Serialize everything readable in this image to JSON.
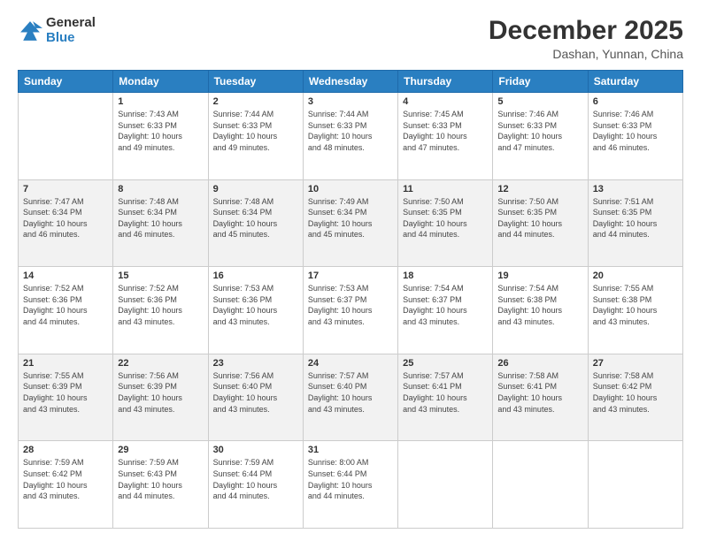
{
  "header": {
    "logo_line1": "General",
    "logo_line2": "Blue",
    "title": "December 2025",
    "subtitle": "Dashan, Yunnan, China"
  },
  "columns": [
    "Sunday",
    "Monday",
    "Tuesday",
    "Wednesday",
    "Thursday",
    "Friday",
    "Saturday"
  ],
  "weeks": [
    [
      {
        "day": "",
        "info": ""
      },
      {
        "day": "1",
        "info": "Sunrise: 7:43 AM\nSunset: 6:33 PM\nDaylight: 10 hours\nand 49 minutes."
      },
      {
        "day": "2",
        "info": "Sunrise: 7:44 AM\nSunset: 6:33 PM\nDaylight: 10 hours\nand 49 minutes."
      },
      {
        "day": "3",
        "info": "Sunrise: 7:44 AM\nSunset: 6:33 PM\nDaylight: 10 hours\nand 48 minutes."
      },
      {
        "day": "4",
        "info": "Sunrise: 7:45 AM\nSunset: 6:33 PM\nDaylight: 10 hours\nand 47 minutes."
      },
      {
        "day": "5",
        "info": "Sunrise: 7:46 AM\nSunset: 6:33 PM\nDaylight: 10 hours\nand 47 minutes."
      },
      {
        "day": "6",
        "info": "Sunrise: 7:46 AM\nSunset: 6:33 PM\nDaylight: 10 hours\nand 46 minutes."
      }
    ],
    [
      {
        "day": "7",
        "info": "Sunrise: 7:47 AM\nSunset: 6:34 PM\nDaylight: 10 hours\nand 46 minutes."
      },
      {
        "day": "8",
        "info": "Sunrise: 7:48 AM\nSunset: 6:34 PM\nDaylight: 10 hours\nand 46 minutes."
      },
      {
        "day": "9",
        "info": "Sunrise: 7:48 AM\nSunset: 6:34 PM\nDaylight: 10 hours\nand 45 minutes."
      },
      {
        "day": "10",
        "info": "Sunrise: 7:49 AM\nSunset: 6:34 PM\nDaylight: 10 hours\nand 45 minutes."
      },
      {
        "day": "11",
        "info": "Sunrise: 7:50 AM\nSunset: 6:35 PM\nDaylight: 10 hours\nand 44 minutes."
      },
      {
        "day": "12",
        "info": "Sunrise: 7:50 AM\nSunset: 6:35 PM\nDaylight: 10 hours\nand 44 minutes."
      },
      {
        "day": "13",
        "info": "Sunrise: 7:51 AM\nSunset: 6:35 PM\nDaylight: 10 hours\nand 44 minutes."
      }
    ],
    [
      {
        "day": "14",
        "info": "Sunrise: 7:52 AM\nSunset: 6:36 PM\nDaylight: 10 hours\nand 44 minutes."
      },
      {
        "day": "15",
        "info": "Sunrise: 7:52 AM\nSunset: 6:36 PM\nDaylight: 10 hours\nand 43 minutes."
      },
      {
        "day": "16",
        "info": "Sunrise: 7:53 AM\nSunset: 6:36 PM\nDaylight: 10 hours\nand 43 minutes."
      },
      {
        "day": "17",
        "info": "Sunrise: 7:53 AM\nSunset: 6:37 PM\nDaylight: 10 hours\nand 43 minutes."
      },
      {
        "day": "18",
        "info": "Sunrise: 7:54 AM\nSunset: 6:37 PM\nDaylight: 10 hours\nand 43 minutes."
      },
      {
        "day": "19",
        "info": "Sunrise: 7:54 AM\nSunset: 6:38 PM\nDaylight: 10 hours\nand 43 minutes."
      },
      {
        "day": "20",
        "info": "Sunrise: 7:55 AM\nSunset: 6:38 PM\nDaylight: 10 hours\nand 43 minutes."
      }
    ],
    [
      {
        "day": "21",
        "info": "Sunrise: 7:55 AM\nSunset: 6:39 PM\nDaylight: 10 hours\nand 43 minutes."
      },
      {
        "day": "22",
        "info": "Sunrise: 7:56 AM\nSunset: 6:39 PM\nDaylight: 10 hours\nand 43 minutes."
      },
      {
        "day": "23",
        "info": "Sunrise: 7:56 AM\nSunset: 6:40 PM\nDaylight: 10 hours\nand 43 minutes."
      },
      {
        "day": "24",
        "info": "Sunrise: 7:57 AM\nSunset: 6:40 PM\nDaylight: 10 hours\nand 43 minutes."
      },
      {
        "day": "25",
        "info": "Sunrise: 7:57 AM\nSunset: 6:41 PM\nDaylight: 10 hours\nand 43 minutes."
      },
      {
        "day": "26",
        "info": "Sunrise: 7:58 AM\nSunset: 6:41 PM\nDaylight: 10 hours\nand 43 minutes."
      },
      {
        "day": "27",
        "info": "Sunrise: 7:58 AM\nSunset: 6:42 PM\nDaylight: 10 hours\nand 43 minutes."
      }
    ],
    [
      {
        "day": "28",
        "info": "Sunrise: 7:59 AM\nSunset: 6:42 PM\nDaylight: 10 hours\nand 43 minutes."
      },
      {
        "day": "29",
        "info": "Sunrise: 7:59 AM\nSunset: 6:43 PM\nDaylight: 10 hours\nand 44 minutes."
      },
      {
        "day": "30",
        "info": "Sunrise: 7:59 AM\nSunset: 6:44 PM\nDaylight: 10 hours\nand 44 minutes."
      },
      {
        "day": "31",
        "info": "Sunrise: 8:00 AM\nSunset: 6:44 PM\nDaylight: 10 hours\nand 44 minutes."
      },
      {
        "day": "",
        "info": ""
      },
      {
        "day": "",
        "info": ""
      },
      {
        "day": "",
        "info": ""
      }
    ]
  ]
}
